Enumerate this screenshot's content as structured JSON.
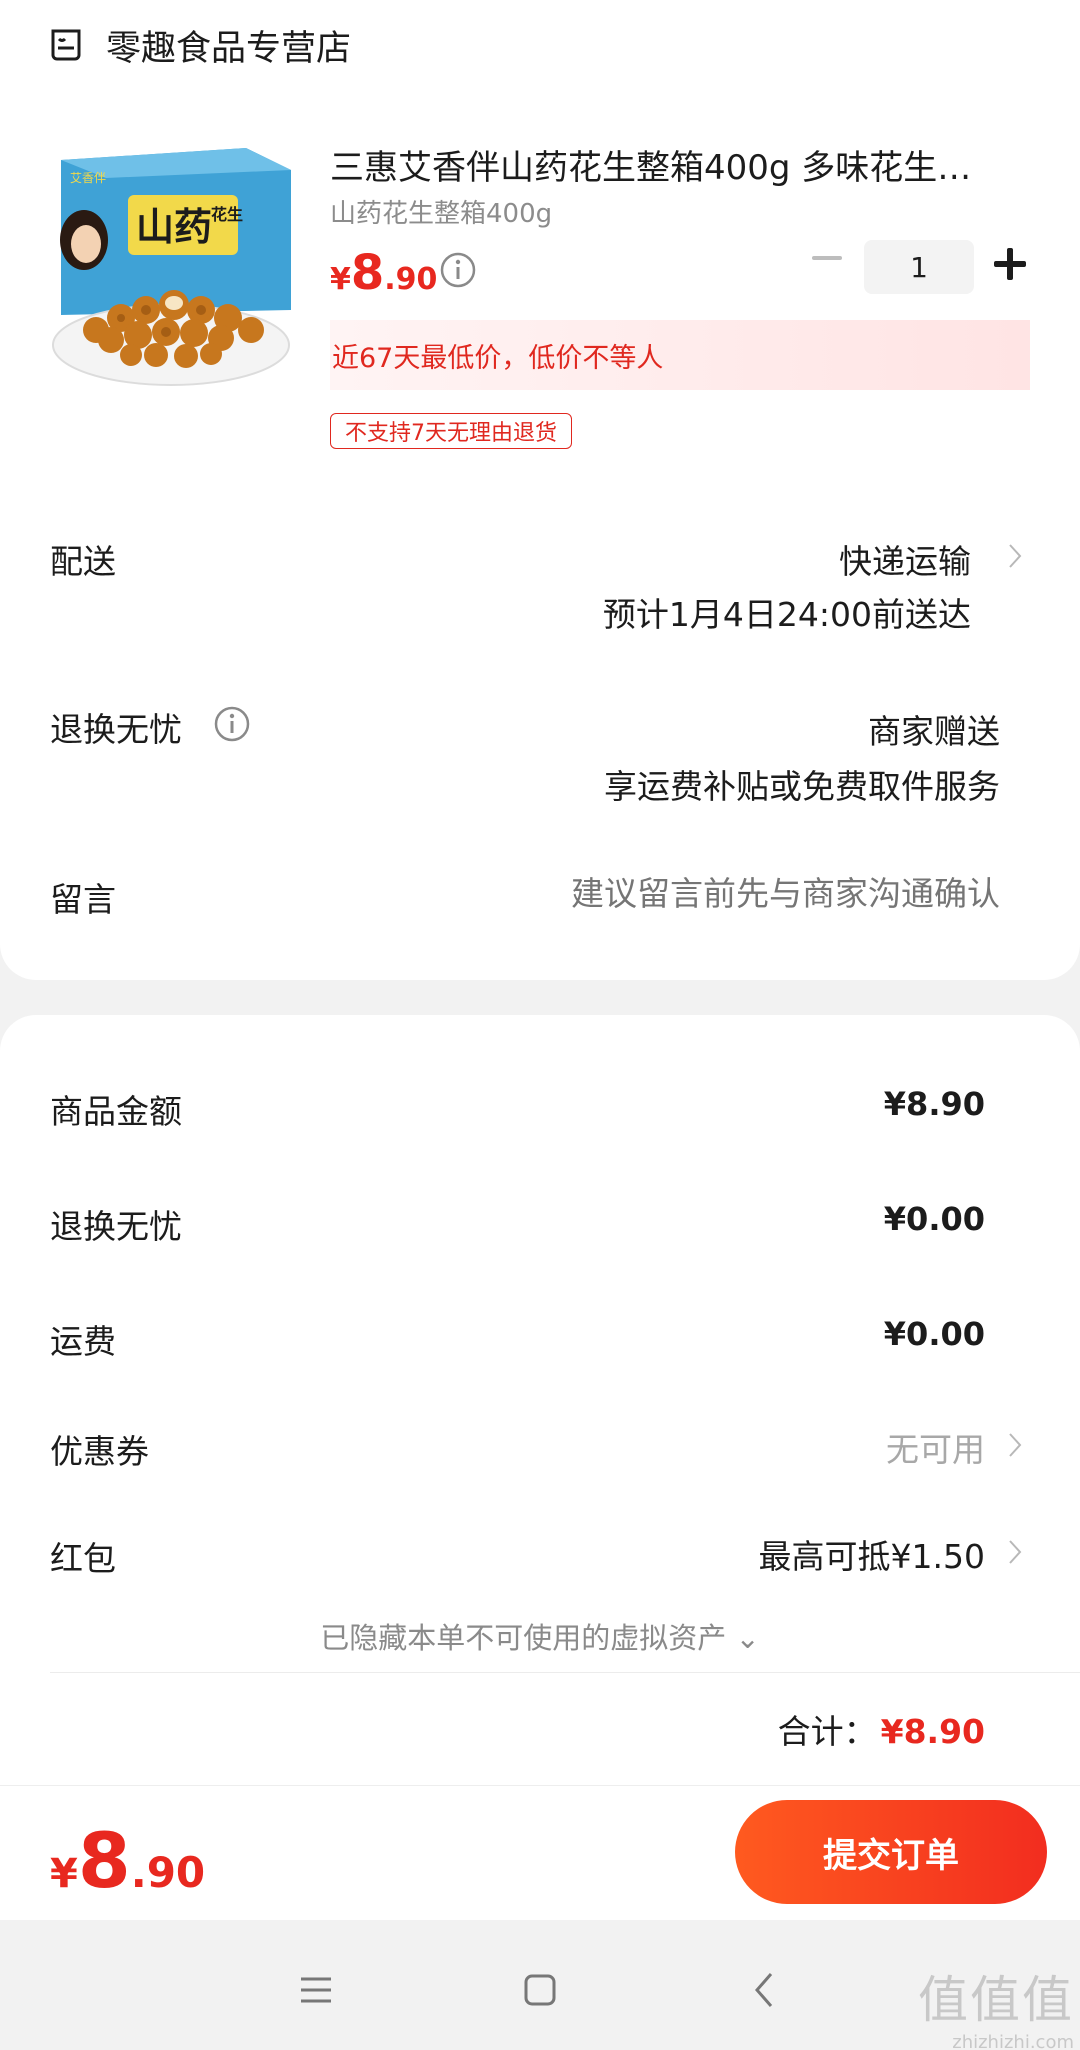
{
  "store": {
    "name": "零趣食品专营店",
    "icon": "store-icon"
  },
  "product": {
    "title": "三惠艾香伴山药花生整箱400g 多味花生…",
    "spec": "山药花生整箱400g",
    "price": {
      "yen": "¥",
      "int": "8",
      "dec": ".90"
    },
    "quantity": "1",
    "low_price_note": "近67天最低价，低价不等人",
    "no_return_tag": "不支持7天无理由退货",
    "image": {
      "box_label": "山药",
      "box_label_small": "花生",
      "brand": "艾香伴"
    }
  },
  "delivery": {
    "label": "配送",
    "method": "快递运输",
    "eta": "预计1月4日24:00前送达"
  },
  "worry_free": {
    "label": "退换无忧",
    "value": "商家赠送",
    "desc": "享运费补贴或免费取件服务"
  },
  "message": {
    "label": "留言",
    "placeholder": "建议留言前先与商家沟通确认"
  },
  "summary": {
    "goods": {
      "label": "商品金额",
      "value": "¥8.90"
    },
    "worry_free": {
      "label": "退换无忧",
      "value": "¥0.00"
    },
    "shipping": {
      "label": "运费",
      "value": "¥0.00"
    },
    "coupon": {
      "label": "优惠券",
      "value": "无可用"
    },
    "red_packet": {
      "label": "红包",
      "value": "最高可抵¥1.50"
    },
    "hidden_assets": "已隐藏本单不可使用的虚拟资产 ⌄",
    "total_label": "合计：",
    "total_value": "¥8.90"
  },
  "bottom": {
    "price": {
      "yen": "¥",
      "int": "8",
      "dec": ".90"
    },
    "submit_label": "提交订单"
  },
  "watermark": {
    "line1": "值值值",
    "line2": "zhizhizhi.com"
  },
  "colors": {
    "accent": "#e8281f",
    "button_start": "#ff5a1f",
    "button_end": "#f22d1f",
    "muted": "#a8a8a8"
  }
}
